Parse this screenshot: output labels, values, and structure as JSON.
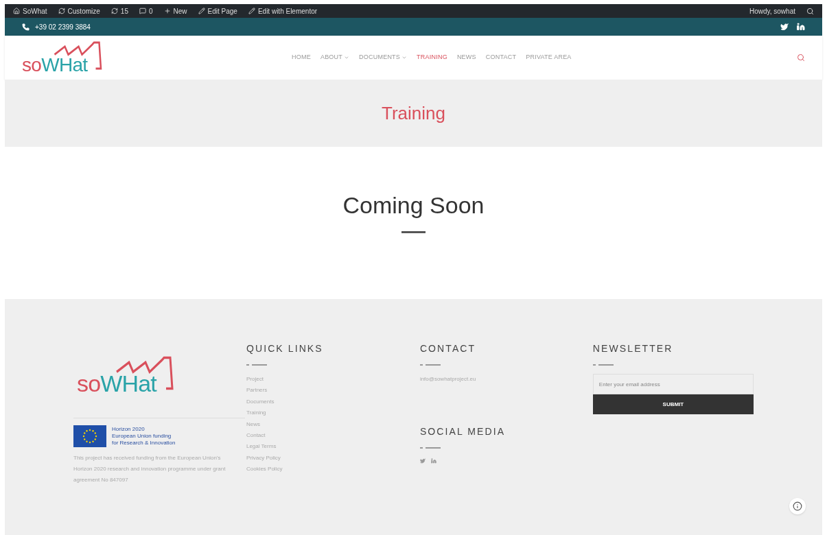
{
  "admin_bar": {
    "items": [
      "SoWhat",
      "Customize",
      "15",
      "0",
      "New",
      "Edit Page",
      "Edit with Elementor"
    ],
    "user": "Howdy, sowhat"
  },
  "top_bar": {
    "phone": "+39 02 2399 3884"
  },
  "header": {
    "logo": "soWHat",
    "nav": [
      {
        "label": "HOME",
        "selected": false,
        "dropdown": false
      },
      {
        "label": "ABOUT",
        "selected": false,
        "dropdown": true
      },
      {
        "label": "DOCUMENTS",
        "selected": false,
        "dropdown": true
      },
      {
        "label": "TRAINING",
        "selected": true,
        "dropdown": false
      },
      {
        "label": "NEWS",
        "selected": false,
        "dropdown": false
      },
      {
        "label": "CONTACT",
        "selected": false,
        "dropdown": false
      },
      {
        "label": "PRIVATE AREA",
        "selected": false,
        "dropdown": false
      }
    ]
  },
  "page_title": "Training",
  "content": {
    "heading": "Coming Soon"
  },
  "footer": {
    "logo": "soWHat",
    "eu_text": [
      "Horizon 2020",
      "European Union funding",
      "for Research & Innovation"
    ],
    "disclaimer": "This project has received funding from the European Union's Horizon 2020 research and innovation programme under grant agreement No 847097",
    "quick_links": {
      "title": "QUICK LINKS",
      "links": [
        "Project",
        "Partners",
        "Documents",
        "Training",
        "News",
        "Contact",
        "Legal Terms",
        "Privacy Policy",
        "Cookies Policy"
      ]
    },
    "contact": {
      "title": "CONTACT",
      "email": "info@sowhatproject.eu"
    },
    "social": {
      "title": "SOCIAL MEDIA"
    },
    "newsletter": {
      "title": "NEWSLETTER",
      "placeholder": "Enter your email address",
      "button": "SUBMIT"
    }
  }
}
